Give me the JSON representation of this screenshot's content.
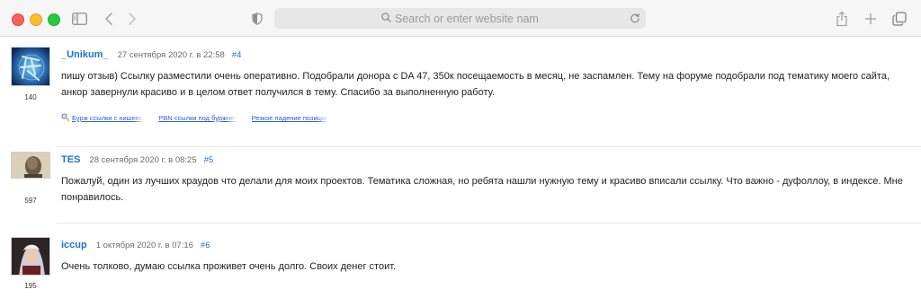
{
  "browser": {
    "address_placeholder": "Search or enter website name",
    "icons": [
      "sidebar-icon",
      "back-icon",
      "forward-icon",
      "shield-icon",
      "search-icon",
      "reload-icon",
      "share-icon",
      "new-tab-icon",
      "tabs-overview-icon"
    ]
  },
  "posts": [
    {
      "author": "_Unikum_",
      "date": "27 сентября 2020 г. в 22:58",
      "number": "#4",
      "reputation": "140",
      "text": "пишу отзыв) Ссылку разместили очень оперативно. Подобрали донора с DA 47, 350к посещаемость в месяц, не заспамлен. Тему на форуме подобрали под тематику моего сайта, анкор завернули красиво и в целом ответ получился в тему.  Спасибо за выполненную работу.",
      "links": [
        "Бурж ссылки с нишевы",
        "PBN ссылки под буржнет",
        "Резкое падение позиций"
      ]
    },
    {
      "author": "TES",
      "date": "28 сентября 2020 г. в 08:25",
      "number": "#5",
      "reputation": "597",
      "text": "Пожалуй, один из лучших краудов что делали для моих проектов. Тематика сложная, но ребята нашли нужную тему и красиво вписали ссылку. Что важно - дуфоллоу, в индексе. Мне понравилось."
    },
    {
      "author": "iccup",
      "date": "1 октября 2020 г. в 07:16",
      "number": "#6",
      "reputation": "195",
      "text": "Очень толково, думаю ссылка проживет очень долго. Своих денег стоит."
    }
  ]
}
